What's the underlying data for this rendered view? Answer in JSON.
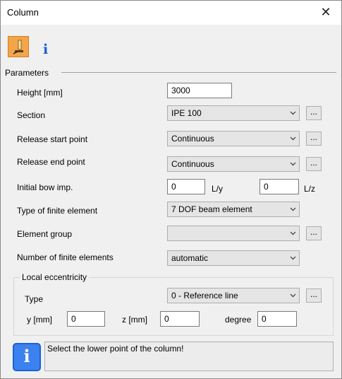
{
  "window": {
    "title": "Column",
    "close_glyph": "✕"
  },
  "toolbar": {
    "pick_icon": "pick-point-icon",
    "info_icon": "info-icon",
    "info_glyph": "i"
  },
  "parameters": {
    "group_title": "Parameters",
    "height": {
      "label": "Height [mm]",
      "value": "3000"
    },
    "section": {
      "label": "Section",
      "value": "IPE 100"
    },
    "release_start": {
      "label": "Release start point",
      "value": "Continuous"
    },
    "release_end": {
      "label": "Release end point",
      "value": "Continuous"
    },
    "initial_bow": {
      "label": "Initial bow imp.",
      "value1": "0",
      "unit1": "L/y",
      "value2": "0",
      "unit2": "L/z"
    },
    "fe_type": {
      "label": "Type of finite element",
      "value": "7 DOF beam element"
    },
    "element_group": {
      "label": "Element group",
      "value": ""
    },
    "num_fe": {
      "label": "Number of finite elements",
      "value": "automatic"
    },
    "dots_label": "..."
  },
  "eccentricity": {
    "title": "Local eccentricity",
    "type": {
      "label": "Type",
      "value": "0 - Reference line"
    },
    "y": {
      "label": "y [mm]",
      "value": "0"
    },
    "z": {
      "label": "z [mm]",
      "value": "0"
    },
    "degree": {
      "label": "degree",
      "value": "0"
    }
  },
  "status": {
    "icon": "info-icon",
    "glyph": "i",
    "message": "Select the lower point of the column!"
  },
  "colors": {
    "tool_button": "#f3a54b",
    "info_blue": "#1e5bd6",
    "status_icon": "#3b82f0"
  }
}
